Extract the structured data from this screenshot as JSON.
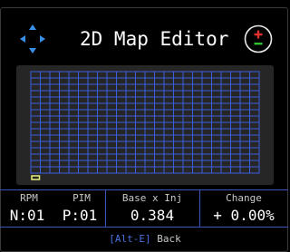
{
  "header": {
    "title": "2D Map Editor",
    "nav_icon": "four-way-arrows-icon",
    "adjust_icon": "plus-minus-icon"
  },
  "map": {
    "columns": 24,
    "rows": 16,
    "selected_cell": {
      "col": 1,
      "row": 16
    },
    "grid_color": "#3a5fe0",
    "cursor_color": "#e8f07a"
  },
  "readout": {
    "headers": {
      "rpm": "RPM",
      "pim": "PIM",
      "base": "Base x Inj",
      "change": "Change"
    },
    "values": {
      "rpm": "N:01",
      "pim": "P:01",
      "base": "0.384",
      "change": "+ 0.00%"
    }
  },
  "footer": {
    "open_bracket": "[",
    "key": "Alt-E",
    "close_bracket": "]",
    "label": "Back"
  },
  "colors": {
    "accent": "#3a55c0",
    "arrow": "#3a8fe6",
    "plus": "#e03030",
    "minus": "#30c030"
  }
}
